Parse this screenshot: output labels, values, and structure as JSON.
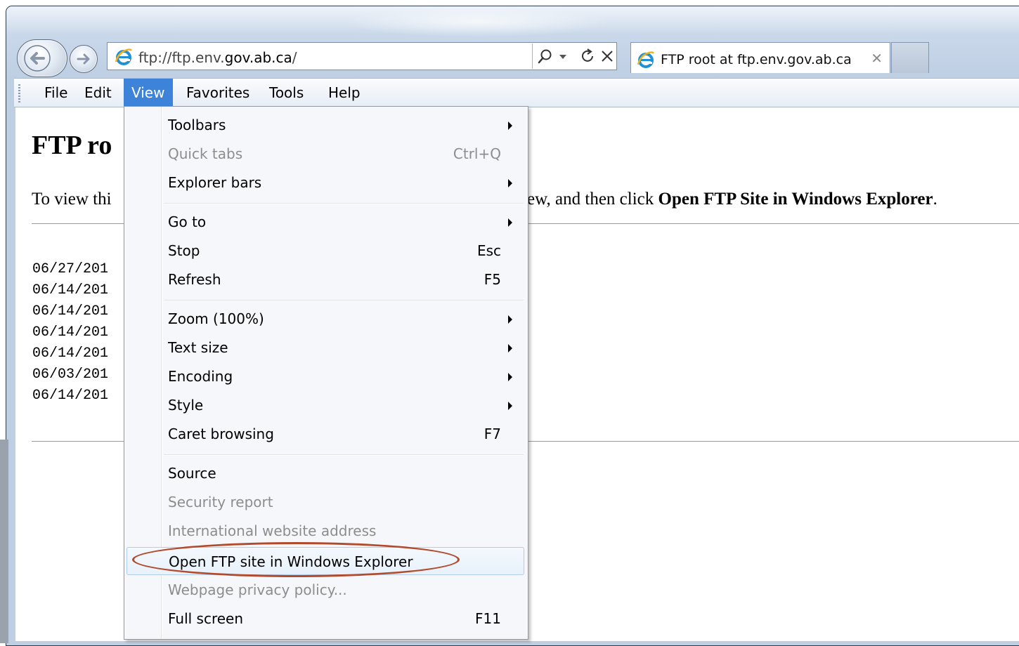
{
  "browser": {
    "address_prefix": "ftp://ftp.env.",
    "address_domain": "gov.ab.ca",
    "address_suffix": "/",
    "search_icon": "search-icon",
    "dropdown_icon": "chevron-down-icon",
    "refresh_icon": "refresh-icon",
    "stop_icon": "close-icon",
    "tab_title": "FTP root at ftp.env.gov.ab.ca",
    "tab_close": "✕",
    "accent_color": "#3c83d9"
  },
  "menubar": {
    "items": [
      "File",
      "Edit",
      "View",
      "Favorites",
      "Tools",
      "Help"
    ],
    "active": "View"
  },
  "page": {
    "title": "FTP ro",
    "instructions_left": "To view thi",
    "instructions_right_plain": "ew, and then click ",
    "instructions_right_bold": "Open FTP Site in Windows Explorer",
    "instructions_right_end": ".",
    "listing": [
      "06/27/201",
      "06/14/201",
      "06/14/201",
      "06/14/201",
      "06/14/201",
      "06/03/201",
      "06/14/201"
    ]
  },
  "view_menu": {
    "items": [
      {
        "label": "Toolbars",
        "shortcut": "",
        "submenu": true,
        "disabled": false
      },
      {
        "label": "Quick tabs",
        "shortcut": "Ctrl+Q",
        "submenu": false,
        "disabled": true
      },
      {
        "label": "Explorer bars",
        "shortcut": "",
        "submenu": true,
        "disabled": false
      },
      {
        "label": "Go to",
        "shortcut": "",
        "submenu": true,
        "disabled": false
      },
      {
        "label": "Stop",
        "shortcut": "Esc",
        "submenu": false,
        "disabled": false
      },
      {
        "label": "Refresh",
        "shortcut": "F5",
        "submenu": false,
        "disabled": false
      },
      {
        "label": "Zoom (100%)",
        "shortcut": "",
        "submenu": true,
        "disabled": false
      },
      {
        "label": "Text size",
        "shortcut": "",
        "submenu": true,
        "disabled": false
      },
      {
        "label": "Encoding",
        "shortcut": "",
        "submenu": true,
        "disabled": false
      },
      {
        "label": "Style",
        "shortcut": "",
        "submenu": true,
        "disabled": false
      },
      {
        "label": "Caret browsing",
        "shortcut": "F7",
        "submenu": false,
        "disabled": false
      },
      {
        "label": "Source",
        "shortcut": "",
        "submenu": false,
        "disabled": false
      },
      {
        "label": "Security report",
        "shortcut": "",
        "submenu": false,
        "disabled": true
      },
      {
        "label": "International website address",
        "shortcut": "",
        "submenu": false,
        "disabled": true
      },
      {
        "label": "Open FTP site in Windows Explorer",
        "shortcut": "",
        "submenu": false,
        "disabled": false,
        "highlighted": true
      },
      {
        "label": "Webpage privacy policy...",
        "shortcut": "",
        "submenu": false,
        "disabled": true
      },
      {
        "label": "Full screen",
        "shortcut": "F11",
        "submenu": false,
        "disabled": false
      }
    ],
    "annotation_color": "#b24a2c"
  }
}
